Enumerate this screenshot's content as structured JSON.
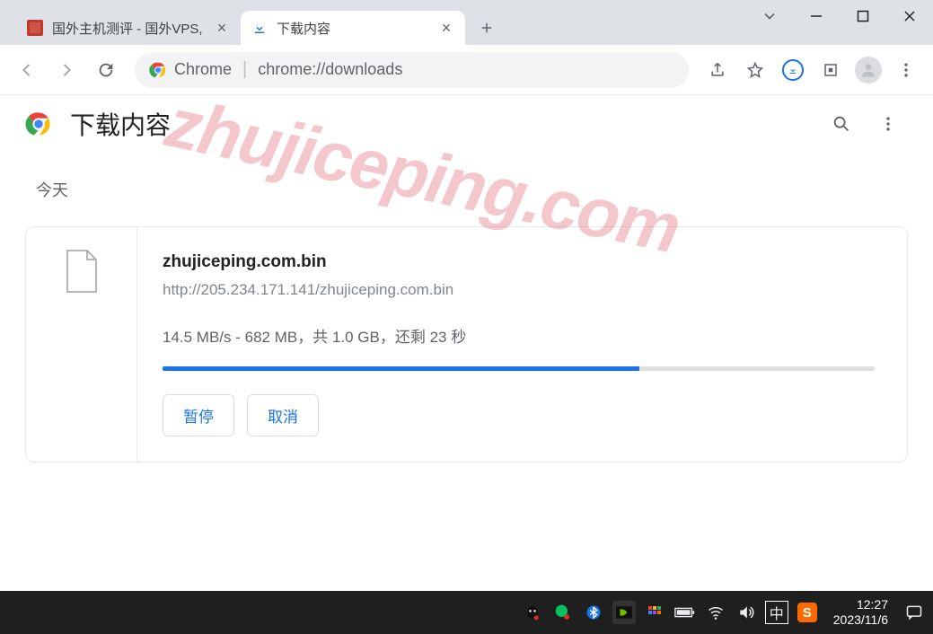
{
  "tabs": [
    {
      "title": "国外主机测评 - 国外VPS,",
      "icon": "red-square"
    },
    {
      "title": "下载内容",
      "icon": "download"
    }
  ],
  "window_controls": {
    "caret": "⌄",
    "minimize": "—",
    "maximize": "☐",
    "close": "✕"
  },
  "toolbar": {
    "omnibox_label": "Chrome",
    "omnibox_url": "chrome://downloads"
  },
  "downloads_page": {
    "header_title": "下载内容",
    "date_label": "今天",
    "item": {
      "file_name": "zhujiceping.com.bin",
      "url": "http://205.234.171.141/zhujiceping.com.bin",
      "speed": "14.5 MB/s",
      "transferred": "682 MB",
      "total": "1.0 GB",
      "remaining": "23 秒",
      "status_line": "14.5 MB/s - 682 MB，共 1.0 GB，还剩 23 秒",
      "progress_percent": 67,
      "pause_label": "暂停",
      "cancel_label": "取消"
    }
  },
  "watermark": "zhujiceping.com",
  "taskbar": {
    "ime": "中",
    "sogou": "S",
    "time": "12:27",
    "date": "2023/11/6"
  }
}
